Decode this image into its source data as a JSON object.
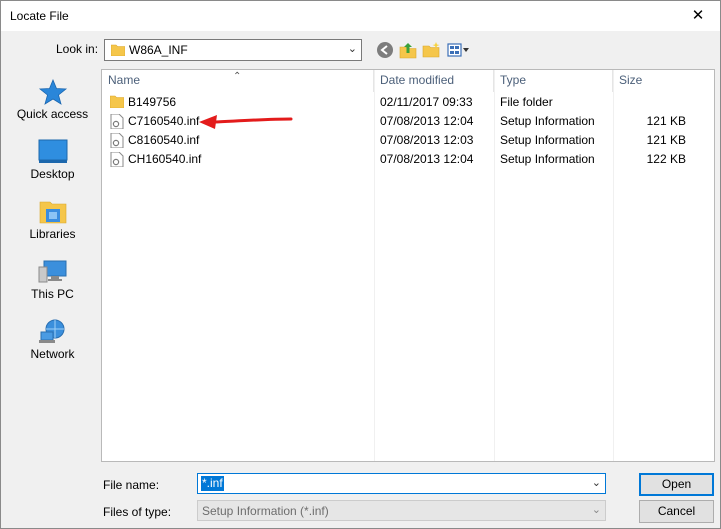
{
  "window": {
    "title": "Locate File",
    "close_glyph": "✕"
  },
  "lookin": {
    "label": "Look in:",
    "value": "W86A_INF"
  },
  "toolbar": {
    "icons": [
      "back-icon",
      "up-folder-icon",
      "new-folder-icon",
      "view-menu-icon"
    ]
  },
  "places": {
    "items": [
      {
        "label": "Quick access",
        "icon": "star-icon"
      },
      {
        "label": "Desktop",
        "icon": "desktop-icon"
      },
      {
        "label": "Libraries",
        "icon": "libraries-icon"
      },
      {
        "label": "This PC",
        "icon": "computer-icon"
      },
      {
        "label": "Network",
        "icon": "network-icon"
      }
    ]
  },
  "filelist": {
    "columns": {
      "name": "Name",
      "date": "Date modified",
      "type": "Type",
      "size": "Size"
    },
    "rows": [
      {
        "name": "B149756",
        "date": "02/11/2017 09:33",
        "type": "File folder",
        "size": "",
        "icon": "folder-icon"
      },
      {
        "name": "C7160540.inf",
        "date": "07/08/2013 12:04",
        "type": "Setup Information",
        "size": "121 KB",
        "icon": "inf-file-icon"
      },
      {
        "name": "C8160540.inf",
        "date": "07/08/2013 12:03",
        "type": "Setup Information",
        "size": "121 KB",
        "icon": "inf-file-icon"
      },
      {
        "name": "CH160540.inf",
        "date": "07/08/2013 12:04",
        "type": "Setup Information",
        "size": "122 KB",
        "icon": "inf-file-icon"
      }
    ]
  },
  "bottom": {
    "filename_label": "File name:",
    "filename_value": "*.inf",
    "filetype_label": "Files of type:",
    "filetype_value": "Setup Information (*.inf)",
    "open_label": "Open",
    "cancel_label": "Cancel"
  },
  "colors": {
    "accent": "#0078d7",
    "annotation_arrow": "#e31b1b",
    "folder": "#f5c64a"
  }
}
